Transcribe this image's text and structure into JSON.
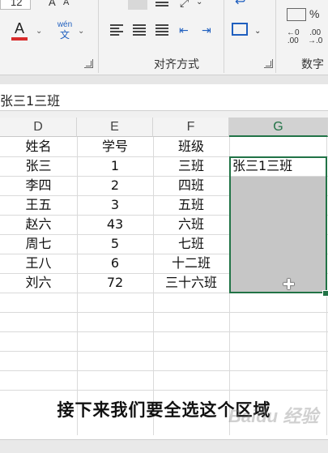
{
  "ribbon": {
    "font_size": "12",
    "font_color_letter": "A",
    "phonetic_top": "wén",
    "phonetic_bottom": "文",
    "alignment_group_label": "对齐方式",
    "number_group_label": "数字",
    "font_color_bar": "#d82b2b",
    "accent_color": "#217346"
  },
  "formula_bar": {
    "value": "张三1三班"
  },
  "columns": [
    "D",
    "E",
    "F",
    "G"
  ],
  "table": {
    "headers": [
      "姓名",
      "学号",
      "班级"
    ],
    "rows": [
      [
        "张三",
        "1",
        "三班"
      ],
      [
        "李四",
        "2",
        "四班"
      ],
      [
        "王五",
        "3",
        "五班"
      ],
      [
        "赵六",
        "43",
        "六班"
      ],
      [
        "周七",
        "5",
        "七班"
      ],
      [
        "王八",
        "6",
        "十二班"
      ],
      [
        "刘六",
        "72",
        "三十六班"
      ]
    ],
    "g_value": "张三1三班"
  },
  "subtitle": "接下来我们要全选这个区域",
  "watermark": "Baidu 经验"
}
